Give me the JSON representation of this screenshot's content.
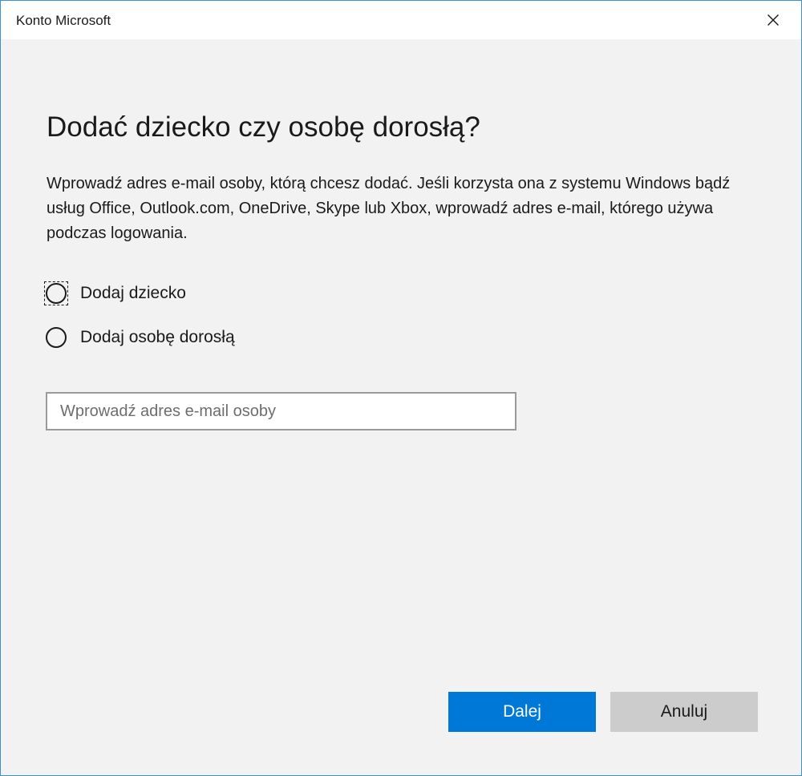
{
  "window": {
    "title": "Konto Microsoft",
    "close_icon": "close-icon"
  },
  "dialog": {
    "heading": "Dodać dziecko czy osobę dorosłą?",
    "description": "Wprowadź adres e-mail osoby, którą chcesz dodać. Jeśli korzysta ona z systemu Windows bądź usług Office, Outlook.com, OneDrive, Skype lub Xbox, wprowadź adres e-mail, którego używa podczas logowania.",
    "options": [
      {
        "label": "Dodaj dziecko",
        "selected": false,
        "focused": true
      },
      {
        "label": "Dodaj osobę dorosłą",
        "selected": false,
        "focused": false
      }
    ],
    "email": {
      "value": "",
      "placeholder": "Wprowadź adres e-mail osoby"
    },
    "buttons": {
      "next_label": "Dalej",
      "cancel_label": "Anuluj"
    }
  },
  "colors": {
    "accent": "#0078d7",
    "window_border": "#3b8fd6",
    "background": "#f2f2f2",
    "cancel_button": "#cccccc"
  }
}
